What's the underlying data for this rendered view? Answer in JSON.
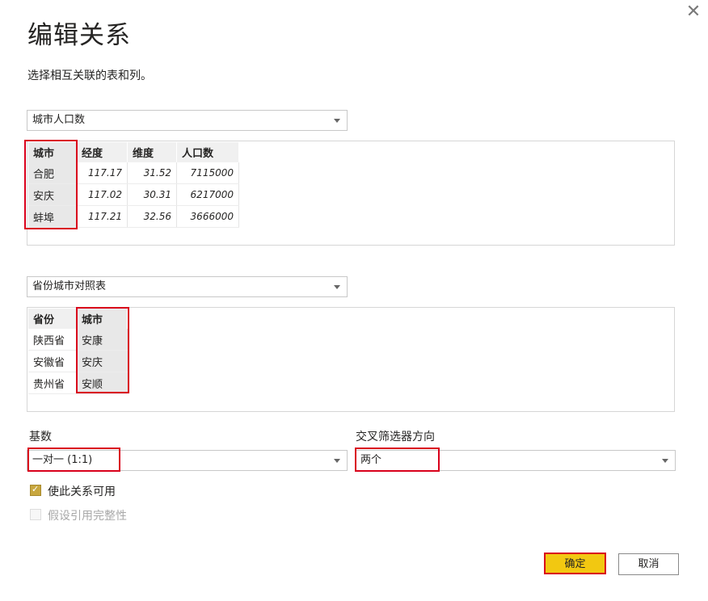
{
  "dialog": {
    "title": "编辑关系",
    "subtitle": "选择相互关联的表和列。",
    "close_icon": "close-icon"
  },
  "table1": {
    "selected": "城市人口数",
    "columns": [
      "城市",
      "经度",
      "维度",
      "人口数"
    ],
    "rows": [
      [
        "合肥",
        "117.17",
        "31.52",
        "7115000"
      ],
      [
        "安庆",
        "117.02",
        "30.31",
        "6217000"
      ],
      [
        "蚌埠",
        "117.21",
        "32.56",
        "3666000"
      ]
    ],
    "selected_column": "城市"
  },
  "table2": {
    "selected": "省份城市对照表",
    "columns": [
      "省份",
      "城市"
    ],
    "rows": [
      [
        "陕西省",
        "安康"
      ],
      [
        "安徽省",
        "安庆"
      ],
      [
        "贵州省",
        "安顺"
      ]
    ],
    "selected_column": "城市"
  },
  "cardinality": {
    "label": "基数",
    "value": "一对一 (1:1)"
  },
  "crossfilter": {
    "label": "交叉筛选器方向",
    "value": "两个"
  },
  "options": {
    "active_label": "使此关系可用",
    "active_checked": true,
    "integrity_label": "假设引用完整性",
    "integrity_checked": false
  },
  "buttons": {
    "ok": "确定",
    "cancel": "取消"
  },
  "colors": {
    "highlight_border": "#d9001b",
    "primary_button": "#f2c811",
    "checkbox_checked": "#c8a73e"
  }
}
